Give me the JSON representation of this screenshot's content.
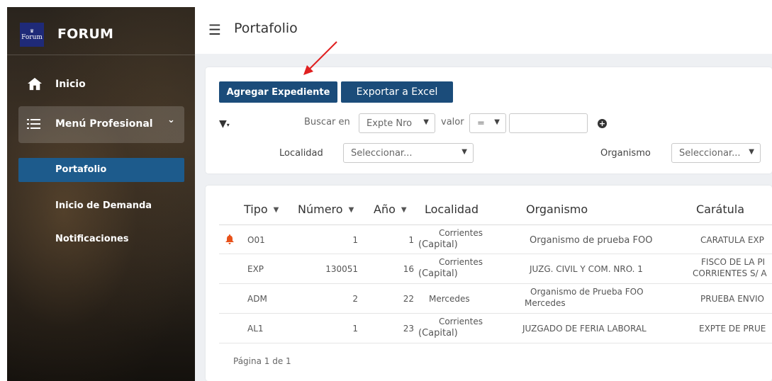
{
  "brand": {
    "logo_text": "Forum",
    "name": "FORUM"
  },
  "sidebar": {
    "items": [
      {
        "label": "Inicio",
        "icon": "home-icon"
      },
      {
        "label": "Menú Profesional",
        "icon": "list-icon"
      }
    ],
    "subitems": [
      {
        "label": "Portafolio",
        "active": true
      },
      {
        "label": "Inicio de Demanda",
        "active": false
      },
      {
        "label": "Notificaciones",
        "active": false
      }
    ]
  },
  "header": {
    "title": "Portafolio"
  },
  "toolbar": {
    "add_label": "Agregar Expediente",
    "export_label": "Exportar a Excel"
  },
  "filters": {
    "buscar_label": "Buscar en",
    "buscar_value": "Expte Nro",
    "valor_label": "valor",
    "operator_value": "=",
    "value_input": "",
    "localidad_label": "Localidad",
    "localidad_value": "Seleccionar...",
    "organismo_label": "Organismo",
    "organismo_value": "Seleccionar..."
  },
  "table": {
    "columns": [
      "Tipo",
      "Número",
      "Año",
      "Localidad",
      "Organismo",
      "Carátula"
    ],
    "rows": [
      {
        "tipo": "O01",
        "numero": "1",
        "anio": "1",
        "localidad_1": "Corrientes",
        "localidad_2": "(Capital)",
        "organismo_1": "Organismo de prueba FOO",
        "organismo_2": "",
        "caratula_1": "CARATULA EXP",
        "caratula_2": "",
        "alert": true
      },
      {
        "tipo": "EXP",
        "numero": "130051",
        "anio": "16",
        "localidad_1": "Corrientes",
        "localidad_2": "(Capital)",
        "organismo_1": "JUZG. CIVIL Y COM. NRO. 1",
        "organismo_2": "",
        "caratula_1": "FISCO DE LA PI",
        "caratula_2": "CORRIENTES S/ A",
        "alert": false
      },
      {
        "tipo": "ADM",
        "numero": "2",
        "anio": "22",
        "localidad_1": "Mercedes",
        "localidad_2": "",
        "organismo_1": "Organismo de Prueba FOO",
        "organismo_2": "Mercedes",
        "caratula_1": "PRUEBA ENVIO",
        "caratula_2": "",
        "alert": false
      },
      {
        "tipo": "AL1",
        "numero": "1",
        "anio": "23",
        "localidad_1": "Corrientes",
        "localidad_2": "(Capital)",
        "organismo_1": "JUZGADO DE FERIA LABORAL",
        "organismo_2": "",
        "caratula_1": "EXPTE DE PRUE",
        "caratula_2": "",
        "alert": false
      }
    ],
    "pager": "Página 1 de 1"
  },
  "colors": {
    "primary": "#1b4c7a",
    "active_nav": "#1d5b8c",
    "alert": "#e8521a",
    "annotation_arrow": "#e02020"
  }
}
